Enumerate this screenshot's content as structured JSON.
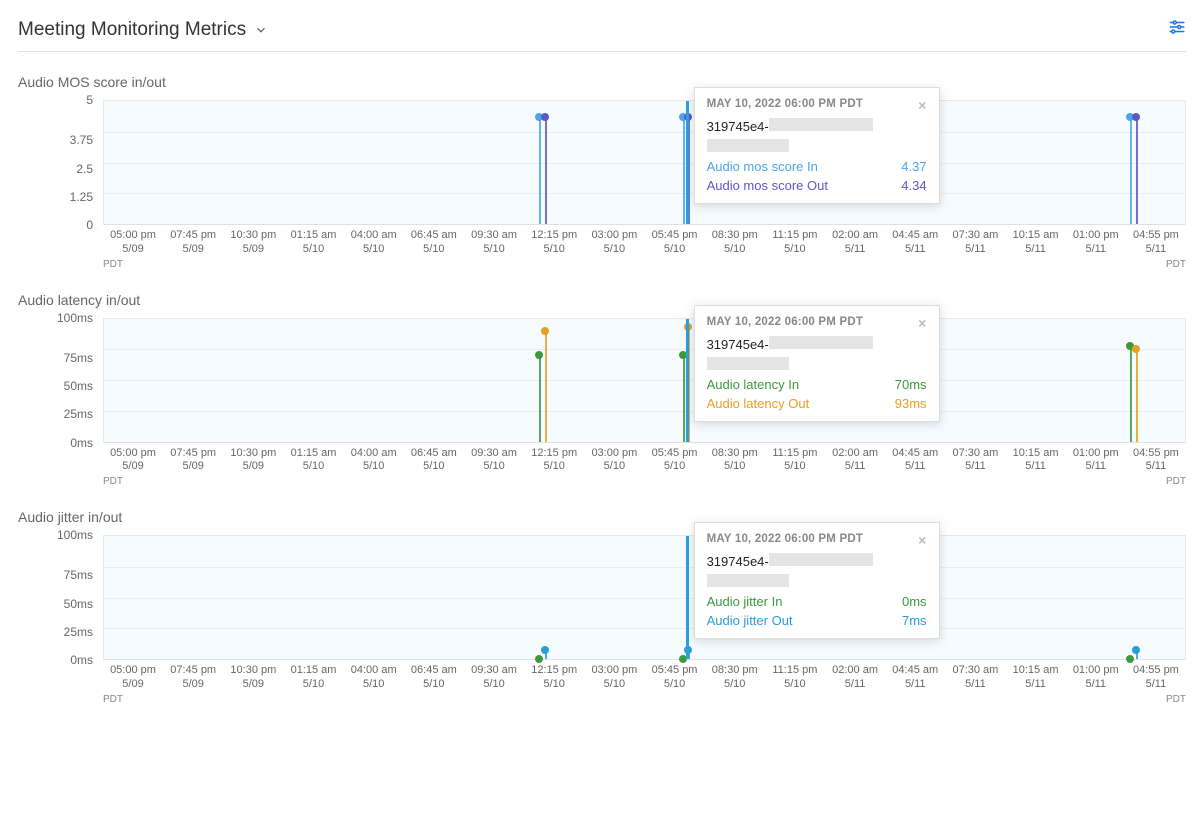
{
  "header": {
    "title": "Meeting Monitoring Metrics"
  },
  "timezone": "PDT",
  "xaxis_ticks": [
    {
      "t": "05:00 pm",
      "d": "5/09"
    },
    {
      "t": "07:45 pm",
      "d": "5/09"
    },
    {
      "t": "10:30 pm",
      "d": "5/09"
    },
    {
      "t": "01:15 am",
      "d": "5/10"
    },
    {
      "t": "04:00 am",
      "d": "5/10"
    },
    {
      "t": "06:45 am",
      "d": "5/10"
    },
    {
      "t": "09:30 am",
      "d": "5/10"
    },
    {
      "t": "12:15 pm",
      "d": "5/10"
    },
    {
      "t": "03:00 pm",
      "d": "5/10"
    },
    {
      "t": "05:45 pm",
      "d": "5/10"
    },
    {
      "t": "08:30 pm",
      "d": "5/10"
    },
    {
      "t": "11:15 pm",
      "d": "5/10"
    },
    {
      "t": "02:00 am",
      "d": "5/11"
    },
    {
      "t": "04:45 am",
      "d": "5/11"
    },
    {
      "t": "07:30 am",
      "d": "5/11"
    },
    {
      "t": "10:15 am",
      "d": "5/11"
    },
    {
      "t": "01:00 pm",
      "d": "5/11"
    },
    {
      "t": "04:55 pm",
      "d": "5/11"
    }
  ],
  "tooltip_common": {
    "timestamp": "MAY 10, 2022 06:00 PM PDT",
    "id_prefix": "319745e4-"
  },
  "charts": [
    {
      "title": "Audio MOS score in/out",
      "yticks": [
        "5",
        "3.75",
        "2.5",
        "1.25",
        "0"
      ],
      "tooltip_metrics": [
        {
          "label": "Audio mos score In",
          "value": "4.37",
          "color": "#4aa6e8"
        },
        {
          "label": "Audio mos score Out",
          "value": "4.34",
          "color": "#5c58c8"
        }
      ]
    },
    {
      "title": "Audio latency in/out",
      "yticks": [
        "100ms",
        "75ms",
        "50ms",
        "25ms",
        "0ms"
      ],
      "tooltip_metrics": [
        {
          "label": "Audio latency In",
          "value": "70ms",
          "color": "#3c9a3c"
        },
        {
          "label": "Audio latency Out",
          "value": "93ms",
          "color": "#e6a020"
        }
      ]
    },
    {
      "title": "Audio jitter in/out",
      "yticks": [
        "100ms",
        "75ms",
        "50ms",
        "25ms",
        "0ms"
      ],
      "tooltip_metrics": [
        {
          "label": "Audio jitter In",
          "value": "0ms",
          "color": "#3c9a3c"
        },
        {
          "label": "Audio jitter Out",
          "value": "7ms",
          "color": "#2a9dd6"
        }
      ]
    }
  ],
  "chart_data": [
    {
      "type": "lollipop",
      "title": "Audio MOS score in/out",
      "ylabel": "",
      "xlabel": "",
      "ylim": [
        0,
        5
      ],
      "x": [
        "5/10 10:30 am",
        "5/10 06:00 pm",
        "5/11 04:00 pm"
      ],
      "series": [
        {
          "name": "Audio mos score In",
          "color": "#4aa6e8",
          "values": [
            4.37,
            4.37,
            4.37
          ]
        },
        {
          "name": "Audio mos score Out",
          "color": "#5c58c8",
          "values": [
            4.34,
            4.34,
            4.34
          ]
        }
      ]
    },
    {
      "type": "lollipop",
      "title": "Audio latency in/out",
      "ylabel": "",
      "xlabel": "",
      "ylim": [
        0,
        100
      ],
      "unit": "ms",
      "x": [
        "5/10 10:30 am",
        "5/10 06:00 pm",
        "5/11 04:00 pm"
      ],
      "series": [
        {
          "name": "Audio latency In",
          "color": "#3c9a3c",
          "values": [
            70,
            70,
            78
          ]
        },
        {
          "name": "Audio latency Out",
          "color": "#e6a020",
          "values": [
            90,
            93,
            75
          ]
        }
      ]
    },
    {
      "type": "lollipop",
      "title": "Audio jitter in/out",
      "ylabel": "",
      "xlabel": "",
      "ylim": [
        0,
        100
      ],
      "unit": "ms",
      "x": [
        "5/10 10:30 am",
        "5/10 06:00 pm",
        "5/11 04:00 pm"
      ],
      "series": [
        {
          "name": "Audio jitter In",
          "color": "#3c9a3c",
          "values": [
            0,
            0,
            0
          ]
        },
        {
          "name": "Audio jitter Out",
          "color": "#2a9dd6",
          "values": [
            7,
            7,
            7
          ]
        }
      ]
    }
  ]
}
